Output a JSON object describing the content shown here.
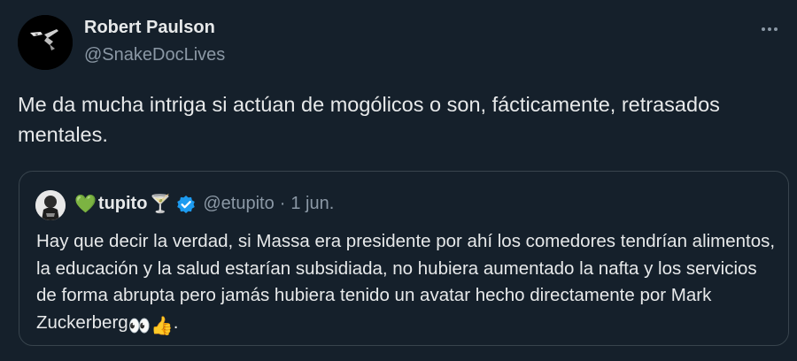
{
  "author": {
    "display_name": "Robert Paulson",
    "handle": "@SnakeDocLives"
  },
  "tweet": {
    "text": "Me da mucha intriga si actúan de mogólicos o son, fácticamente, retrasados mentales."
  },
  "quoted_tweet": {
    "name_prefix_emoji": "💚",
    "display_name": "tupito",
    "name_suffix_emoji": "🍸",
    "verified": true,
    "handle": "@etupito",
    "separator": "·",
    "date": "1 jun.",
    "text": "Hay que decir la verdad, si Massa era presidente por ahí los comedores tendrían alimentos, la educación y la salud estarían subsidiada, no hubiera aumentado la nafta y los servicios de forma abrupta pero jamás hubiera tenido un avatar hecho directamente por Mark Zuckerberg",
    "text_end_emojis": "👀👍",
    "text_end_punct": "."
  },
  "icons": {
    "more": "more-horizontal-icon",
    "verified": "verified-badge-icon"
  },
  "colors": {
    "background": "#15202b",
    "text_primary": "#e7e9ea",
    "text_secondary": "#8b98a5",
    "border": "#38444d",
    "verified_blue": "#1d9bf0"
  }
}
